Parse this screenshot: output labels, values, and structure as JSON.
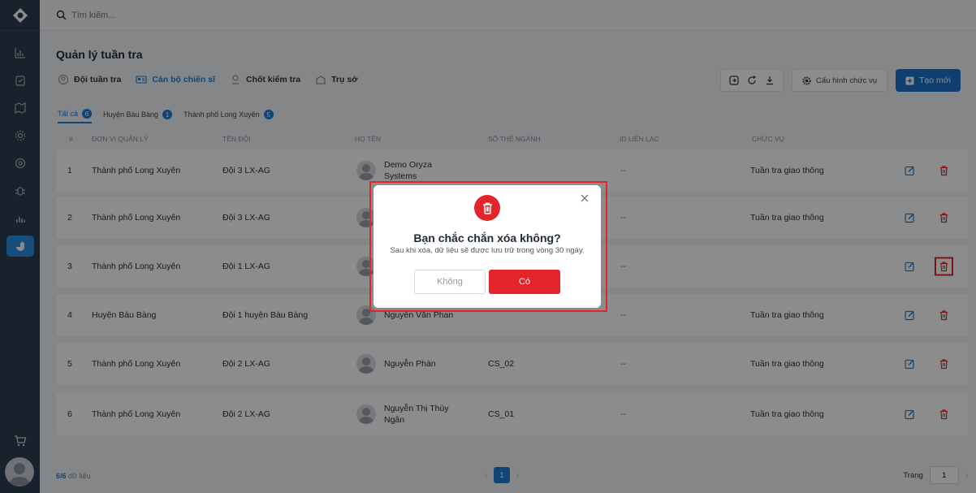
{
  "search": {
    "placeholder": "Tìm kiếm..."
  },
  "page": {
    "title": "Quản lý tuần tra"
  },
  "subtabs": [
    {
      "label": "Đội tuần tra"
    },
    {
      "label": "Cán bộ chiến sĩ"
    },
    {
      "label": "Chốt kiểm tra"
    },
    {
      "label": "Trụ sở"
    }
  ],
  "toolbar": {
    "config_label": "Cấu hình chức vụ",
    "create_label": "Tạo mới"
  },
  "filters": [
    {
      "label": "Tất cả",
      "count": "6"
    },
    {
      "label": "Huyện Bàu Bàng",
      "count": "1"
    },
    {
      "label": "Thành phố Long Xuyên",
      "count": "5"
    }
  ],
  "table": {
    "headers": [
      "#",
      "Đơn vị quản lý",
      "Tên đội",
      "Họ tên",
      "Số thẻ ngành",
      "ID liên lạc",
      "Chức vụ"
    ],
    "rows": [
      {
        "num": "1",
        "unit": "Thành phố Long Xuyên",
        "team": "Đội 3 LX-AG",
        "name": "Demo Oryza Systems",
        "card": "",
        "contact": "--",
        "role": "Tuần tra giao thông"
      },
      {
        "num": "2",
        "unit": "Thành phố Long Xuyên",
        "team": "Đội 3 LX-AG",
        "name": "",
        "card": "",
        "contact": "--",
        "role": "Tuần tra giao thông"
      },
      {
        "num": "3",
        "unit": "Thành phố Long Xuyên",
        "team": "Đội 1 LX-AG",
        "name": "",
        "card": "",
        "contact": "--",
        "role": ""
      },
      {
        "num": "4",
        "unit": "Huyện Bàu Bàng",
        "team": "Đội 1 huyện Bàu Bàng",
        "name": "Nguyễn Văn Phan",
        "card": "",
        "contact": "--",
        "role": "Tuần tra giao thông"
      },
      {
        "num": "5",
        "unit": "Thành phố Long Xuyên",
        "team": "Đội 2 LX-AG",
        "name": "Nguyễn Phàn",
        "card": "CS_02",
        "contact": "--",
        "role": "Tuần tra giao thông"
      },
      {
        "num": "6",
        "unit": "Thành phố Long Xuyên",
        "team": "Đội 2 LX-AG",
        "name": "Nguyễn Thị Thùy Ngân",
        "card": "CS_01",
        "contact": "--",
        "role": "Tuần tra giao thông"
      }
    ]
  },
  "footer": {
    "total_count": "6/6",
    "total_suffix": "dữ liệu",
    "current_page": "1",
    "goto_label": "Trang",
    "goto_value": "1"
  },
  "modal": {
    "title": "Bạn chắc chắn xóa không?",
    "message": "Sau khi xóa, dữ liệu sẽ được lưu trữ trong vòng 30 ngày.",
    "cancel_label": "Không",
    "confirm_label": "Có"
  },
  "colors": {
    "primary": "#1e7fd6",
    "danger": "#e3242b",
    "sidebar": "#2c3e50"
  }
}
